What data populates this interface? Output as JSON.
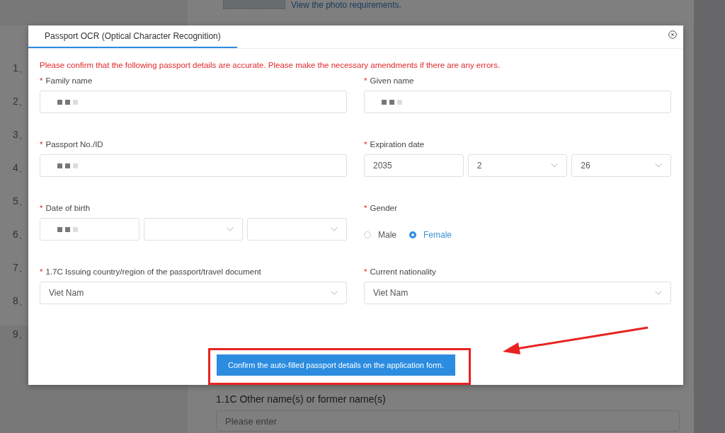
{
  "background": {
    "photo_link": "View the photo requirements.",
    "steps": [
      "1、",
      "2、",
      "3、",
      "4、",
      "5、",
      "6、",
      "7、",
      "8、",
      "9、"
    ],
    "other_names": {
      "label": "1.1C Other name(s) or former name(s)",
      "placeholder": "Please enter"
    }
  },
  "modal": {
    "tab_title": "Passport OCR (Optical Character Recognition)",
    "notice": "Please confirm that the following passport details are accurate. Please make the necessary amendments if there are any errors.",
    "fields": [
      {
        "label": "Family name",
        "required_mark": "*",
        "kind": "input",
        "parts": [
          {
            "kind": "redacted"
          }
        ]
      },
      {
        "label": "Given name",
        "required_mark": "*",
        "kind": "input",
        "parts": [
          {
            "kind": "redacted"
          }
        ]
      },
      {
        "label": "Passport No./ID",
        "required_mark": "*",
        "kind": "input",
        "parts": [
          {
            "kind": "redacted"
          }
        ]
      },
      {
        "label": "Expiration date",
        "required_mark": "*",
        "kind": "date",
        "parts": [
          {
            "kind": "text",
            "value": "2035"
          },
          {
            "kind": "select",
            "value": "2"
          },
          {
            "kind": "select",
            "value": "26"
          }
        ]
      },
      {
        "label": "Date of birth",
        "required_mark": "*",
        "kind": "date",
        "parts": [
          {
            "kind": "redacted"
          },
          {
            "kind": "select"
          },
          {
            "kind": "select"
          }
        ]
      },
      {
        "label": "Gender",
        "required_mark": "*",
        "kind": "radio",
        "options": [
          {
            "label": "Male",
            "selected": false
          },
          {
            "label": "Female",
            "selected": true
          }
        ]
      },
      {
        "label": "1.7C Issuing country/region of the passport/travel document",
        "required_mark": "*",
        "kind": "input",
        "parts": [
          {
            "kind": "select",
            "value": "Viet Nam"
          }
        ]
      },
      {
        "label": "Current nationality",
        "required_mark": "*",
        "kind": "input",
        "parts": [
          {
            "kind": "select",
            "value": "Viet Nam"
          }
        ]
      }
    ],
    "confirm_button": "Confirm the auto-filled passport details on the application form."
  }
}
